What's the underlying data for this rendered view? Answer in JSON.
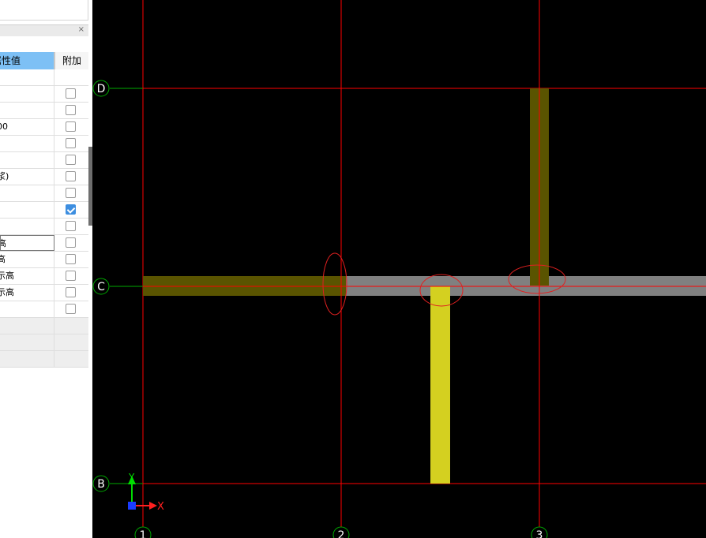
{
  "property_panel": {
    "close_glyph": "×",
    "columns": {
      "value": "属性值",
      "attach": "附加"
    },
    "rows": [
      {
        "value": "",
        "checked": false,
        "has_checkbox": false,
        "grey": false
      },
      {
        "value": "",
        "checked": false,
        "has_checkbox": true,
        "grey": false
      },
      {
        "value": "",
        "checked": false,
        "has_checkbox": true,
        "grey": false
      },
      {
        "value": "00",
        "checked": false,
        "has_checkbox": true,
        "grey": false
      },
      {
        "value": "",
        "checked": false,
        "has_checkbox": true,
        "grey": false
      },
      {
        "value": "",
        "checked": false,
        "has_checkbox": true,
        "grey": false
      },
      {
        "value": "浆)",
        "checked": false,
        "has_checkbox": true,
        "grey": false
      },
      {
        "value": "",
        "checked": false,
        "has_checkbox": true,
        "grey": false
      },
      {
        "value": "",
        "checked": true,
        "has_checkbox": true,
        "grey": false
      },
      {
        "value": "",
        "checked": false,
        "has_checkbox": true,
        "grey": false
      },
      {
        "value": "高",
        "checked": false,
        "has_checkbox": true,
        "grey": false,
        "selected": true
      },
      {
        "value": "高",
        "checked": false,
        "has_checkbox": true,
        "grey": false
      },
      {
        "value": "示高",
        "checked": false,
        "has_checkbox": true,
        "grey": false
      },
      {
        "value": "示高",
        "checked": false,
        "has_checkbox": true,
        "grey": false
      },
      {
        "value": "",
        "checked": false,
        "has_checkbox": true,
        "grey": false
      },
      {
        "value": "",
        "checked": false,
        "has_checkbox": false,
        "grey": true
      },
      {
        "value": "",
        "checked": false,
        "has_checkbox": false,
        "grey": true
      },
      {
        "value": "",
        "checked": false,
        "has_checkbox": false,
        "grey": true
      }
    ]
  },
  "canvas": {
    "background": "#000000",
    "axis_color": "#ff0000",
    "row_axis_color": "#00aa00",
    "grid_rows": [
      "D",
      "C",
      "B"
    ],
    "grid_cols": [
      "1",
      "2",
      "3"
    ],
    "ucs": {
      "x_label": "X",
      "y_label": "Y"
    },
    "colors": {
      "beam_existing": "#5a5400",
      "beam_grey": "#808080",
      "beam_selected": "#d4d020",
      "highlight_ellipse": "#e02020"
    }
  }
}
